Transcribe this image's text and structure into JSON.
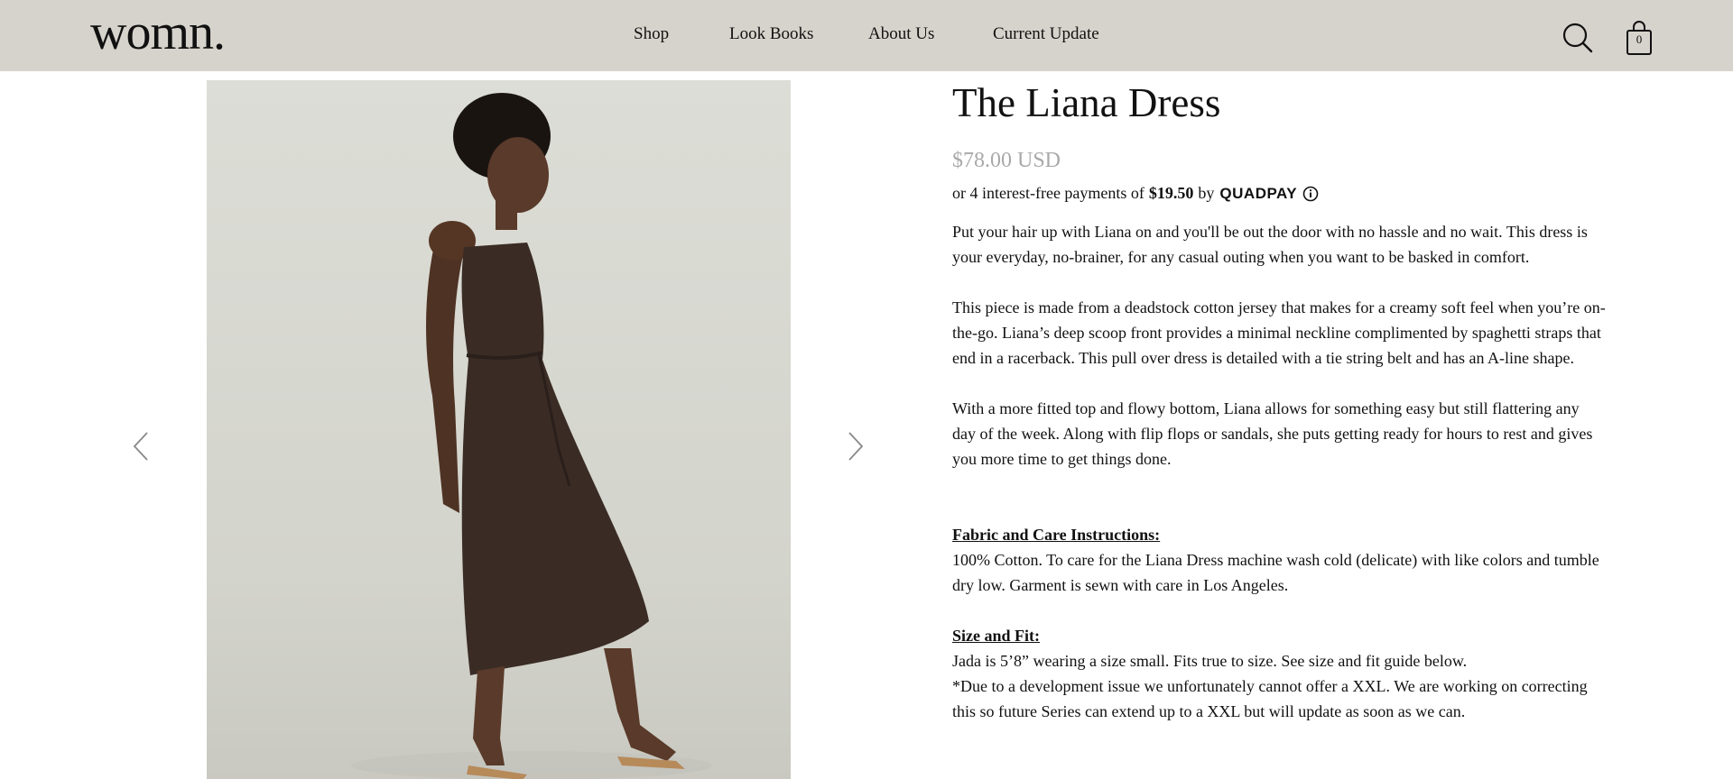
{
  "header": {
    "logo": "womn.",
    "nav": [
      "Shop",
      "Look Books",
      "About Us",
      "Current Update"
    ],
    "cart_count": "0",
    "icons": [
      "search-icon",
      "shopping-bag-icon"
    ]
  },
  "gallery": {
    "image_alt": "Model wearing The Liana Dress in chocolate brown",
    "prev_icon": "chevron-left-icon",
    "next_icon": "chevron-right-icon"
  },
  "product": {
    "title": "The Liana Dress",
    "price": "$78.00 USD",
    "installments": {
      "prefix": "or 4 interest-free payments of",
      "amount": "$19.50",
      "by": "by",
      "provider": "QUADPAY"
    },
    "description": [
      "Put your hair up with Liana on and you'll be out the door with no hassle and no wait. This dress is your everyday, no-brainer, for any casual outing when you want to be basked in comfort.",
      "This piece is made from a deadstock cotton jersey that makes for a creamy soft feel when you’re on-the-go. Liana’s deep scoop front provides a minimal neckline complimented by spaghetti straps that end in a racerback. This pull over dress is detailed with a tie string belt and has an A-line shape.",
      "With a more fitted top and flowy bottom, Liana allows for something easy but still flattering any day of the week. Along with flip flops or sandals, she puts getting ready for hours to rest and gives you more time to get things done."
    ],
    "care": {
      "heading": "Fabric and Care Instructions:",
      "text": "100% Cotton. To care for the Liana Dress machine wash cold (delicate) with like colors and tumble dry low. Garment is sewn with care in Los Angeles."
    },
    "fit": {
      "heading": "Size and Fit:",
      "line1": "Jada is 5’8” wearing a size small. Fits true to size. See size and fit guide below.",
      "line2": "*Due to a development issue we unfortunately cannot offer a XXL. We are working on correcting this so future Series can extend up to a XXL but will update as soon as we can."
    }
  },
  "colors": {
    "header_bg": "#d6d3cc",
    "price": "#a9a9a9",
    "dress": "#3a2c25"
  }
}
